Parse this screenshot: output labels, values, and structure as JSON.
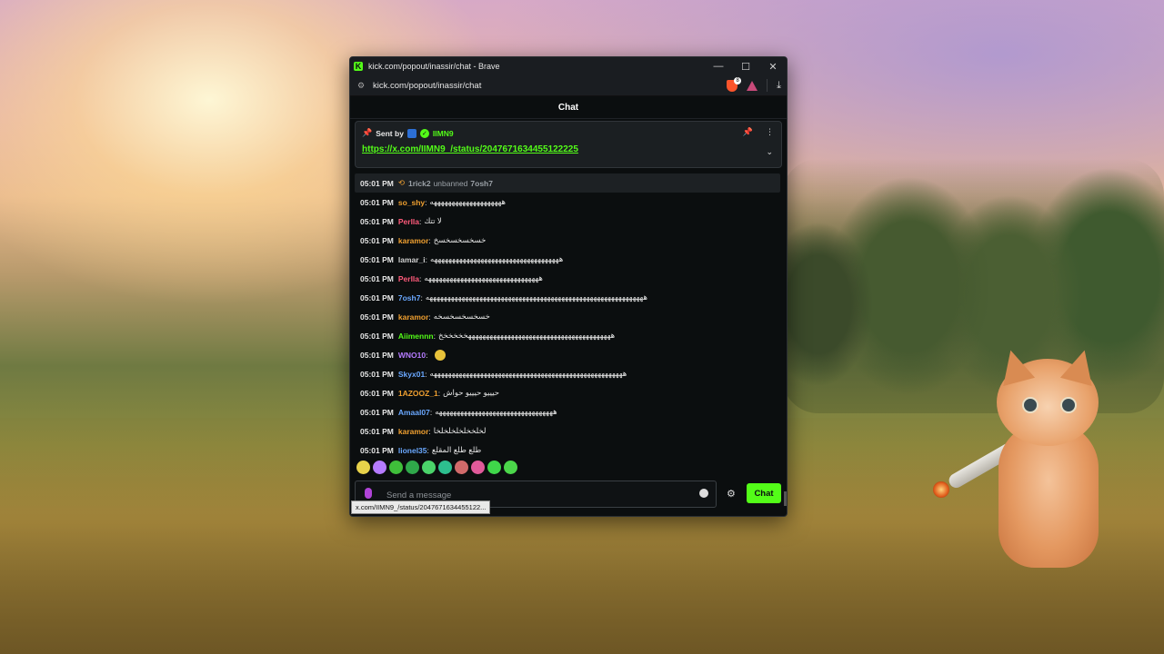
{
  "window": {
    "title": "kick.com/popout/inassir/chat - Brave",
    "logo_letter": "K",
    "controls": {
      "minimize": "—",
      "maximize": "☐",
      "close": "✕"
    }
  },
  "address_bar": {
    "url": "kick.com/popout/inassir/chat",
    "site_info_icon": "tune-icon",
    "shield_badge": "8"
  },
  "chat": {
    "header_title": "Chat",
    "pinned": {
      "sent_by_label": "Sent by",
      "username": "IIMN9",
      "link": "https://x.com/IIMN9_/status/2047671634455122225"
    },
    "messages": [
      {
        "type": "system",
        "time": "05:01 PM",
        "actor": "1rick2",
        "action": "unbanned",
        "target": "7osh7"
      },
      {
        "time": "05:01 PM",
        "user": "so_shy",
        "color": "#f0a030",
        "text": "ههههههههههههههههههههه"
      },
      {
        "time": "05:01 PM",
        "user": "Perlla",
        "color": "#ff5a7a",
        "text": "لا تتك"
      },
      {
        "time": "05:01 PM",
        "user": "karamor",
        "color": "#f0a030",
        "text": "خسخسخسخسخ"
      },
      {
        "time": "05:01 PM",
        "user": "lamar_i",
        "color": "#cfcfcf",
        "text": "ههههههههههههههههههههههههههههههههههههه"
      },
      {
        "time": "05:01 PM",
        "user": "Perlla",
        "color": "#ff5a7a",
        "text": "ههههههههههههههههههههههههههههههههه"
      },
      {
        "time": "05:01 PM",
        "user": "7osh7",
        "color": "#6aa8ff",
        "text": "هههههههههههههههههههههههههههههههههههههههههههههههههههههههههههههه"
      },
      {
        "time": "05:01 PM",
        "user": "karamor",
        "color": "#f0a030",
        "text": "خسخسخسخسخه"
      },
      {
        "time": "05:01 PM",
        "user": "Aiimennn",
        "color": "#53fc18",
        "text": "هههههههههههههههههههههههههههههههههههههههههخخخخخخ"
      },
      {
        "time": "05:01 PM",
        "user": "WNO10",
        "color": "#b57bff",
        "text": ""
      },
      {
        "time": "05:01 PM",
        "user": "Skyx01",
        "color": "#6aa8ff",
        "text": "ههههههههههههههههههههههههههههههههههههههههههههههههههههههه"
      },
      {
        "time": "05:01 PM",
        "user": "1AZOOZ_1",
        "color": "#f0a030",
        "text": "حيييو حيييو حواش"
      },
      {
        "time": "05:01 PM",
        "user": "Amaal07",
        "color": "#6aa8ff",
        "text": "هههههههههههههههههههههههههههههههههه"
      },
      {
        "time": "05:01 PM",
        "user": "karamor",
        "color": "#f0a030",
        "text": "لخلخخلخلخلخلخا"
      },
      {
        "time": "05:01 PM",
        "user": "lionel35",
        "color": "#6aa8ff",
        "text": "طلع طلع المقلع"
      }
    ],
    "composer": {
      "placeholder": "Send a message",
      "send_label": "Chat"
    },
    "status_url": "x.com/IIMN9_/status/2047671634455122..."
  }
}
